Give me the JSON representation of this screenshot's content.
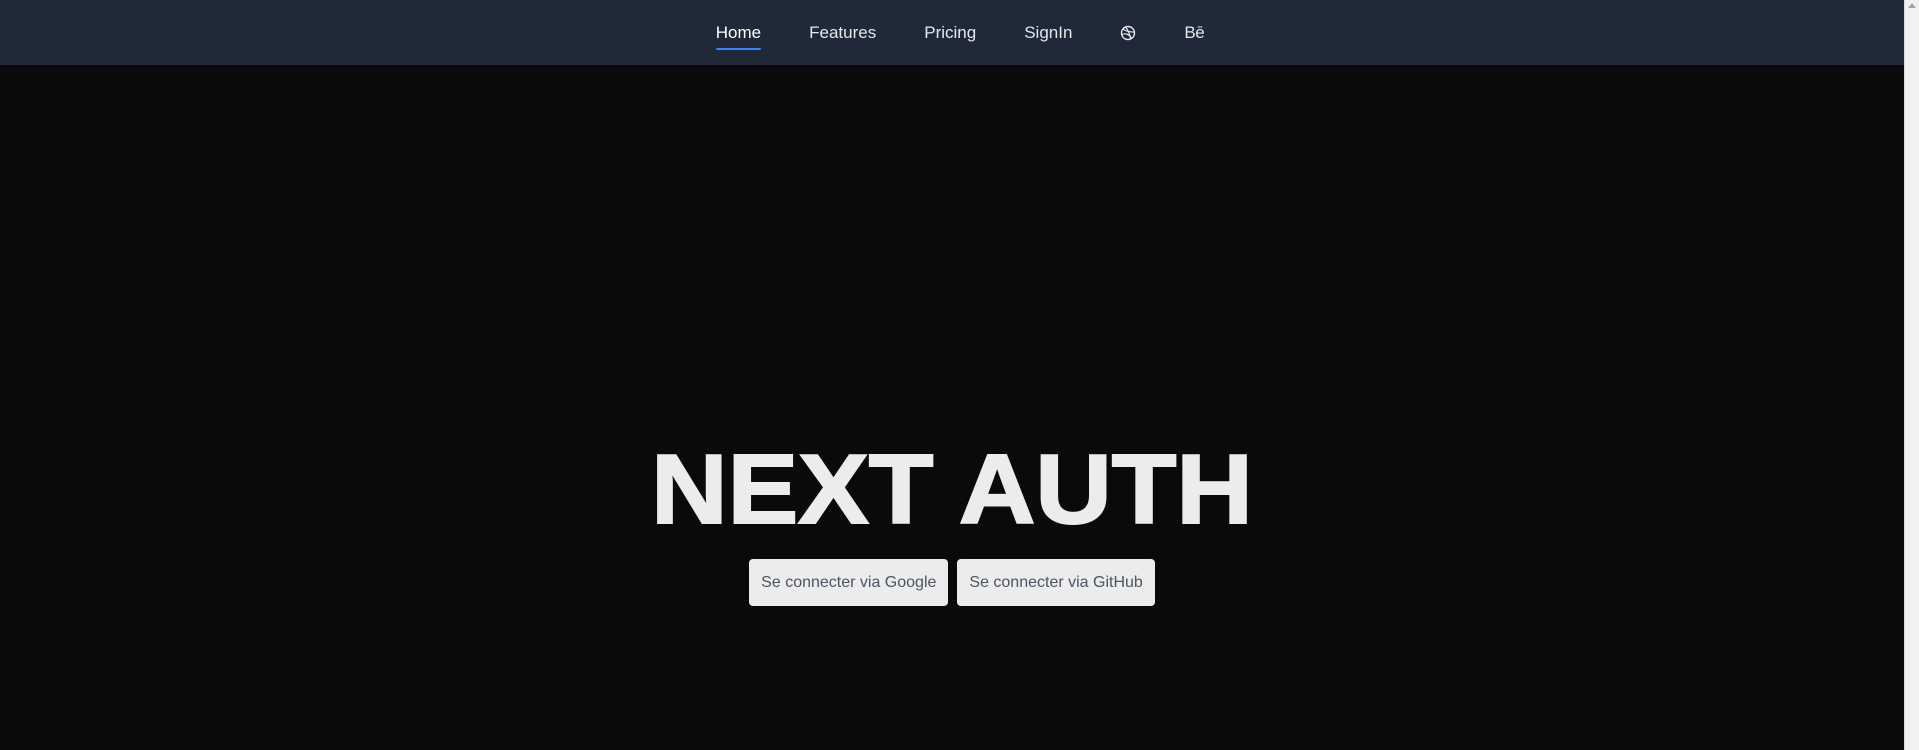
{
  "nav": {
    "items": [
      {
        "label": "Home",
        "active": true
      },
      {
        "label": "Features",
        "active": false
      },
      {
        "label": "Pricing",
        "active": false
      },
      {
        "label": "SignIn",
        "active": false
      }
    ],
    "icons": {
      "dribbble": "dribbble-icon",
      "behance": "Bē"
    },
    "accent_color": "#3b82f6"
  },
  "hero": {
    "title": "NEXT AUTH",
    "google_button": "Se connecter via Google",
    "github_button": "Se connecter via GitHub"
  },
  "colors": {
    "navbar": "#1f2937",
    "background": "#0a0a0a",
    "title": "#ececec",
    "button_bg": "#ececec",
    "button_text": "#4b5563"
  }
}
